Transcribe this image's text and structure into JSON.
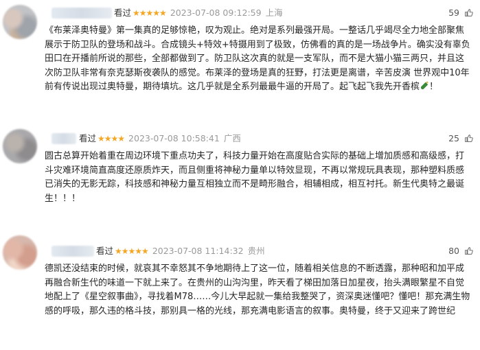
{
  "reviews": [
    {
      "rating_label": "看过",
      "stars": "★★★★★",
      "stars_count": 5,
      "time": "2023-07-08 09:12:59",
      "location": "上海",
      "votes": "59",
      "content": "《布莱泽奥特曼》第一集真的足够惊艳，叹为观止。绝对是系列最强开局。一整话几乎竭尽全力地全部聚焦展示于防卫队的登场和战斗。合成镜头+特效+特摄用到了极致，仿佛看的真的是一场战争片。确实没有辜负田口在开播前所说的那些，全部都做到了。防卫队这次真的就是一支军队，而不是大猫小猫三两只，并且这次防卫队非常有奈克瑟斯夜袭队的感觉。布莱泽的登场是真的狂野，打法更是离谱，辛苦皮演 世界观中10年前有传说出现过奥特曼，期待填坑。这几乎就是全系列最最牛逼的开局了。起飞起飞我先开香槟",
      "content_tail": "！"
    },
    {
      "rating_label": "看过",
      "stars": "★★★★",
      "stars_count": 4,
      "time": "2023-07-08 10:58:41",
      "location": "广西",
      "votes": "25",
      "content": "圆古总算开始着重在周边环境下重点功夫了，科技力量开始在高度贴合实际的基础上增加质感和高级感，打斗灾难环境简直高度还原质炸天，而且侧重将神秘力量单以特效显现，不再以常规玩具表现，那种塑料质感已消失的无影无踪，科技感和神秘力量互相独立而不是畸形融合，相辅相成，相互衬托。新生代奥特之最诞生！！！",
      "content_tail": ""
    },
    {
      "rating_label": "看过",
      "stars": "★★★★★",
      "stars_count": 5,
      "time": "2023-07-08 11:14:32",
      "location": "贵州",
      "votes": "80",
      "content": "德凯还没结束的时候，就哀其不幸怒其不争地期待上了这一位，随着相关信息的不断透露，那种昭和加平成再融合新生代的味道一下就上来了。在贵州的山沟沟里，昨天看了梯田加落日加星夜，抬头满眼繁星不自觉地配上了《星空叙事曲》，寻找着M78……今儿大早起就一集给我整哭了，资深奥迷懂吧？懂吧！那充满生物感的呼吸，那久违的格斗技，那别具一格的光线，那充满电影语言的叙事。奥特曼，终于又迎来了跨世纪",
      "content_tail": ""
    }
  ]
}
